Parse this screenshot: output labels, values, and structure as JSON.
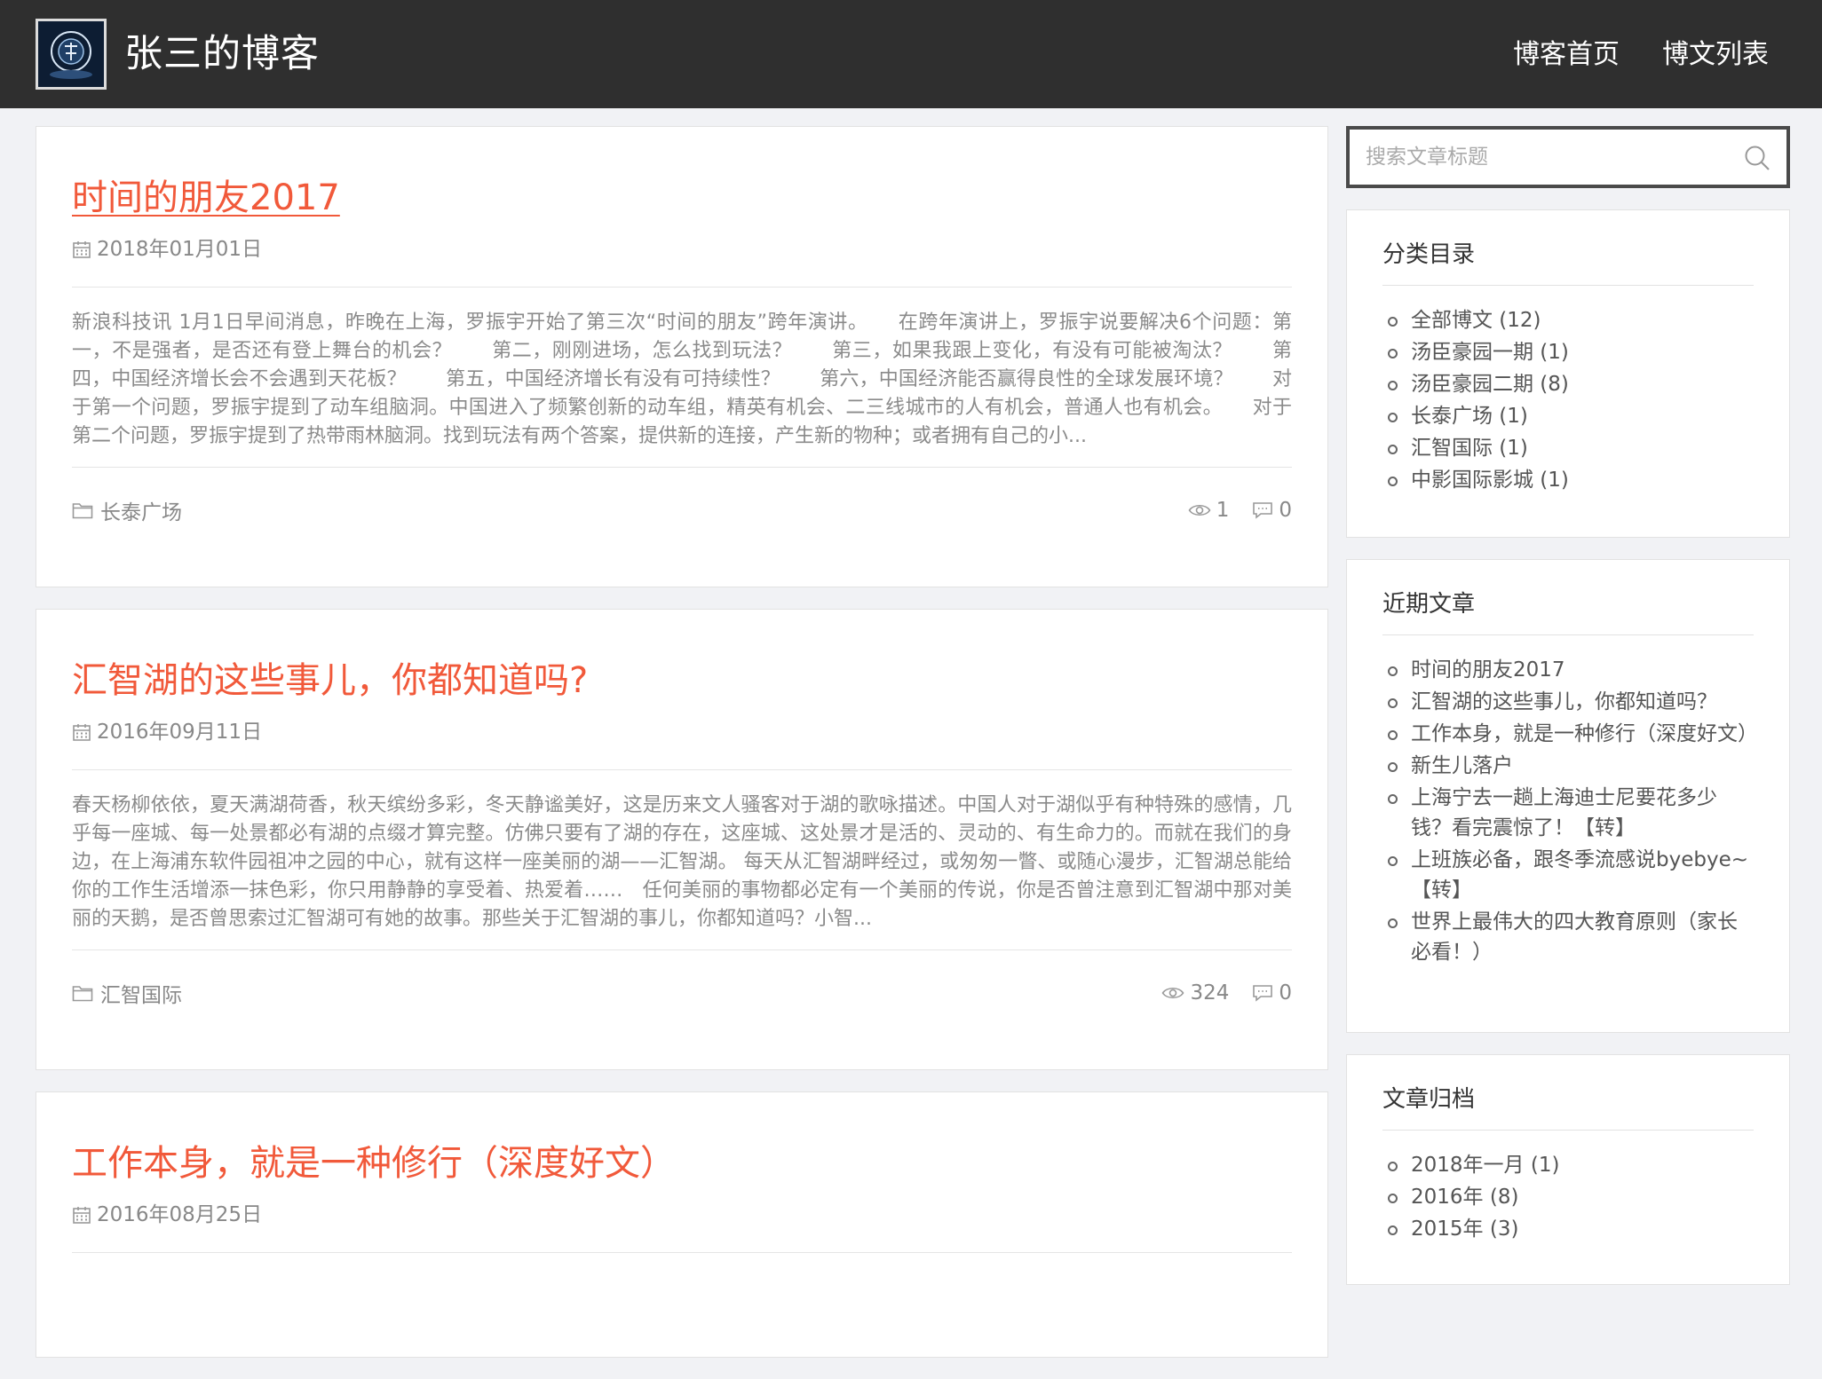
{
  "header": {
    "site_title": "张三的博客",
    "nav": [
      "博客首页",
      "博文列表"
    ]
  },
  "posts": [
    {
      "title": "时间的朋友2017",
      "date": "2018年01月01日",
      "excerpt": "新浪科技讯 1月1日早间消息，昨晚在上海，罗振宇开始了第三次“时间的朋友”跨年演讲。　　在跨年演讲上，罗振宇说要解决6个问题：第一，不是强者，是否还有登上舞台的机会？　　第二，刚刚进场，怎么找到玩法？　　第三，如果我跟上变化，有没有可能被淘汰？　　第四，中国经济增长会不会遇到天花板？　　第五，中国经济增长有没有可持续性？　　第六，中国经济能否赢得良性的全球发展环境？　　对于第一个问题，罗振宇提到了动车组脑洞。中国进入了频繁创新的动车组，精英有机会、二三线城市的人有机会，普通人也有机会。　　对于第二个问题，罗振宇提到了热带雨林脑洞。找到玩法有两个答案，提供新的连接，产生新的物种；或者拥有自己的小...",
      "category": "长泰广场",
      "views": "1",
      "comments": "0"
    },
    {
      "title": "汇智湖的这些事儿，你都知道吗?",
      "date": "2016年09月11日",
      "excerpt": "春天杨柳依依，夏天满湖荷香，秋天缤纷多彩，冬天静谧美好，这是历来文人骚客对于湖的歌咏描述。中国人对于湖似乎有种特殊的感情，几乎每一座城、每一处景都必有湖的点缀才算完整。仿佛只要有了湖的存在，这座城、这处景才是活的、灵动的、有生命力的。而就在我们的身边，在上海浦东软件园祖冲之园的中心，就有这样一座美丽的湖——汇智湖。 每天从汇智湖畔经过，或匆匆一瞥、或随心漫步，汇智湖总能给你的工作生活增添一抹色彩，你只用静静的享受着、热爱着……　任何美丽的事物都必定有一个美丽的传说，你是否曾注意到汇智湖中那对美丽的天鹅，是否曾思索过汇智湖可有她的故事。那些关于汇智湖的事儿，你都知道吗？小智...",
      "category": "汇智国际",
      "views": "324",
      "comments": "0"
    },
    {
      "title": "工作本身，就是一种修行（深度好文）",
      "date": "2016年08月25日"
    }
  ],
  "sidebar": {
    "search_placeholder": "搜索文章标题",
    "categories": {
      "title": "分类目录",
      "items": [
        "全部博文 (12)",
        "汤臣豪园一期 (1)",
        "汤臣豪园二期 (8)",
        "长泰广场 (1)",
        "汇智国际 (1)",
        "中影国际影城 (1)"
      ]
    },
    "recent": {
      "title": "近期文章",
      "items": [
        "时间的朋友2017",
        "汇智湖的这些事儿，你都知道吗？",
        "工作本身，就是一种修行（深度好文）",
        "新生儿落户",
        "上海宁去一趟上海迪士尼要花多少钱？看完震惊了！【转】",
        "上班族必备，跟冬季流感说byebye~【转】",
        "世界上最伟大的四大教育原则（家长必看！）"
      ]
    },
    "archive": {
      "title": "文章归档",
      "items": [
        "2018年一月 (1)",
        "2016年 (8)",
        "2015年 (3)"
      ]
    }
  },
  "colors": {
    "header_bg": "#2f2f2f",
    "accent": "#f1593a",
    "page_bg": "#f1f2f5"
  }
}
